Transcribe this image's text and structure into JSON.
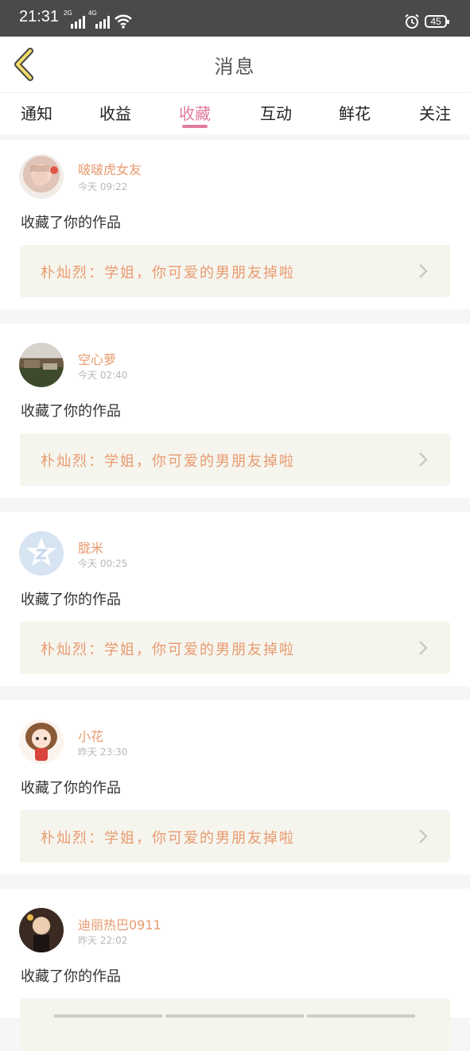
{
  "status_bar": {
    "time": "21:31",
    "signal1_label": "2G",
    "signal2_label": "4G",
    "battery": "45"
  },
  "header": {
    "title": "消息"
  },
  "tabs": [
    {
      "label": "通知"
    },
    {
      "label": "收益"
    },
    {
      "label": "收藏"
    },
    {
      "label": "互动"
    },
    {
      "label": "鲜花"
    },
    {
      "label": "关注"
    }
  ],
  "active_tab": "收藏",
  "colors": {
    "accent": "#e07aa0",
    "username": "#e99a6e",
    "quote_bg": "#f5f5ee"
  },
  "messages": [
    {
      "username": "啵啵虎女友",
      "time": "今天 09:22",
      "action": "收藏了你的作品",
      "quote": "朴灿烈：学姐，你可爱的男朋友掉啦"
    },
    {
      "username": "空心萝",
      "time": "今天 02:40",
      "action": "收藏了你的作品",
      "quote": "朴灿烈：学姐，你可爱的男朋友掉啦"
    },
    {
      "username": "胧米",
      "time": "今天 00:25",
      "action": "收藏了你的作品",
      "quote": "朴灿烈：学姐，你可爱的男朋友掉啦"
    },
    {
      "username": "小花",
      "time": "昨天 23:30",
      "action": "收藏了你的作品",
      "quote": "朴灿烈：学姐，你可爱的男朋友掉啦"
    },
    {
      "username": "迪丽热巴0911",
      "time": "昨天 22:02",
      "action": "收藏了你的作品",
      "quote": ""
    }
  ]
}
